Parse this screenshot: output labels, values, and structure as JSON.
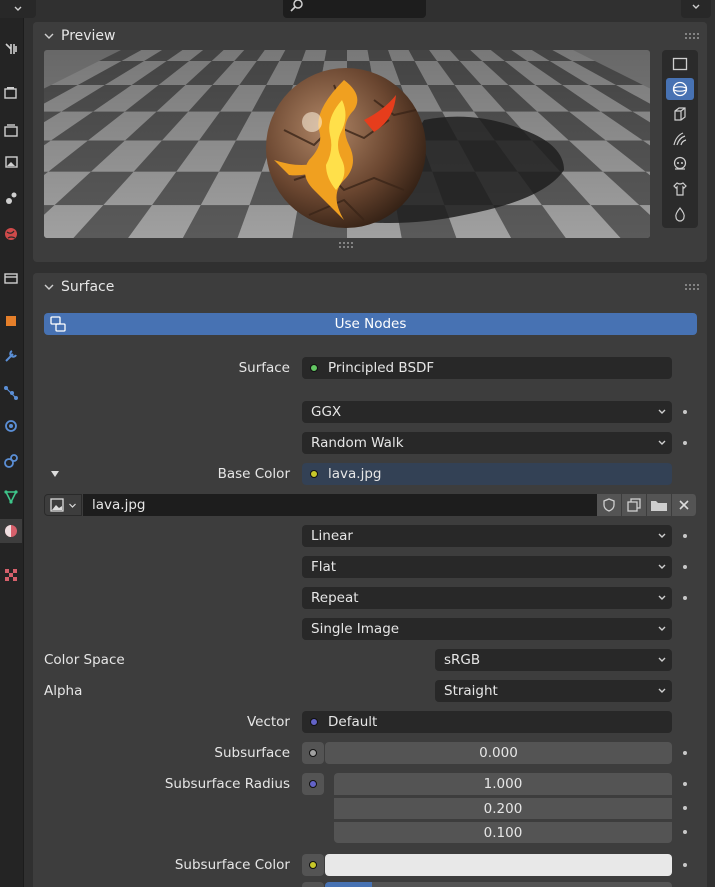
{
  "colors": {
    "accent": "#4772b3",
    "socket_shader": "#63c763",
    "socket_color": "#c7c729",
    "socket_vector": "#6363c7",
    "socket_float": "#a1a1a1"
  },
  "left_tabs": [
    "tool-icon",
    "render-icon",
    "output-icon",
    "view-layer-icon",
    "scene-icon",
    "world-icon",
    "collection-icon",
    "object-icon",
    "modifier-icon",
    "particles-icon",
    "physics-icon",
    "constraints-icon",
    "object-data-icon",
    "material-icon",
    "texture-icon"
  ],
  "header": {
    "search_placeholder": ""
  },
  "preview": {
    "title": "Preview",
    "tools": [
      "plane-icon",
      "sphere-icon",
      "cube-icon",
      "hair-icon",
      "monkey-icon",
      "cloth-icon",
      "fluid-icon"
    ],
    "active_tool": 1
  },
  "surface": {
    "title": "Surface",
    "use_nodes_label": "Use Nodes",
    "surface_label": "Surface",
    "surface_value": "Principled BSDF",
    "distribution": "GGX",
    "subsurface_method": "Random Walk",
    "base_color_label": "Base Color",
    "base_color_value": "lava.jpg",
    "image_name": "lava.jpg",
    "interpolation": "Linear",
    "projection": "Flat",
    "extension": "Repeat",
    "source": "Single Image",
    "color_space_label": "Color Space",
    "color_space_value": "sRGB",
    "alpha_label": "Alpha",
    "alpha_value": "Straight",
    "vector_label": "Vector",
    "vector_value": "Default",
    "subsurface_label": "Subsurface",
    "subsurface_value": "0.000",
    "subsurface_radius_label": "Subsurface Radius",
    "subsurface_radius": [
      "1.000",
      "0.200",
      "0.100"
    ],
    "subsurface_color_label": "Subsurface Color",
    "subsurface_color": "#e8e8e8"
  }
}
